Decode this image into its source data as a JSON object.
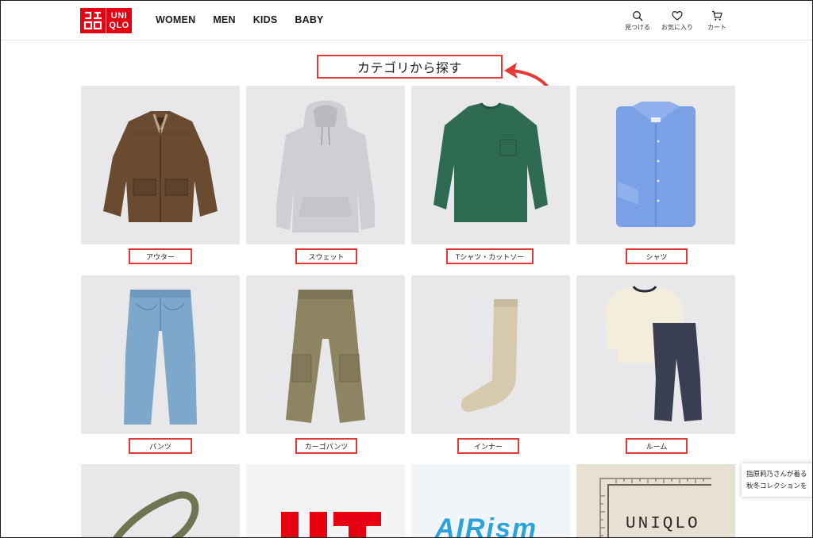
{
  "header": {
    "logo_top": "ユニクロ",
    "logo_bottom": "UNIQLO",
    "nav": [
      "WOMEN",
      "MEN",
      "KIDS",
      "BABY"
    ],
    "icons": [
      {
        "label": "見つける",
        "icon": "search-icon"
      },
      {
        "label": "お気に入り",
        "icon": "heart-icon"
      },
      {
        "label": "カート",
        "icon": "cart-icon"
      }
    ]
  },
  "section": {
    "title": "カテゴリから探す"
  },
  "categories": [
    {
      "label": "アウター"
    },
    {
      "label": "スウェット"
    },
    {
      "label": "Tシャツ・カットソー"
    },
    {
      "label": "シャツ"
    },
    {
      "label": "パンツ"
    },
    {
      "label": "カーゴパンツ"
    },
    {
      "label": "インナー"
    },
    {
      "label": "ルーム"
    }
  ],
  "bottom_tiles": {
    "airism_text": "AIRism",
    "uniqlo_text": "UNIQLO"
  },
  "toast": {
    "line1": "指原莉乃さんが着る",
    "line2": "秋冬コレクションを"
  },
  "colors": {
    "brand": "#e60012",
    "annotation": "#e53935"
  }
}
